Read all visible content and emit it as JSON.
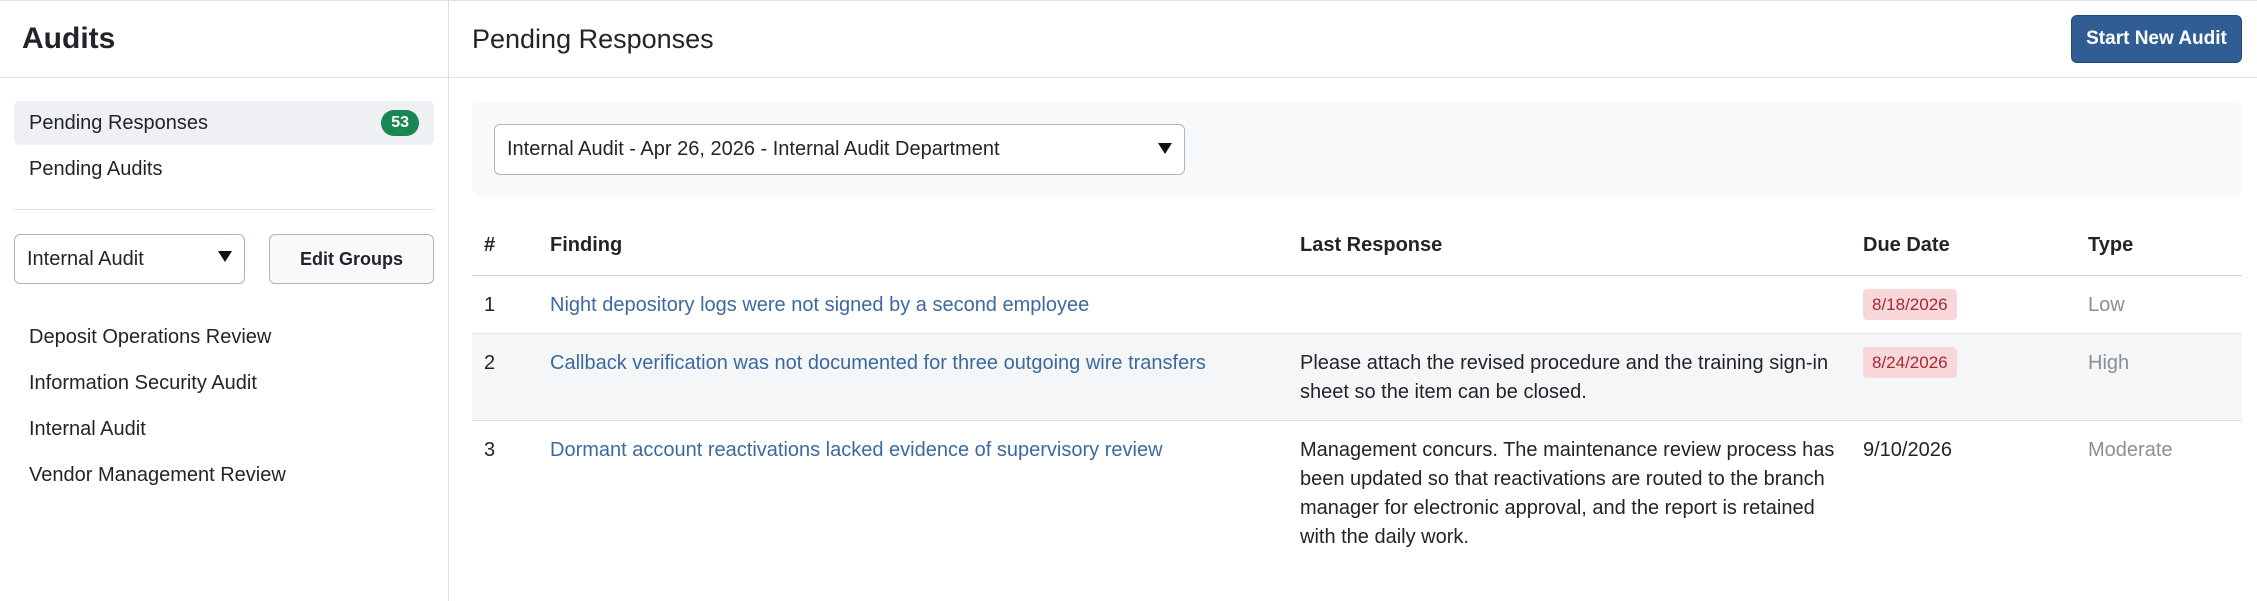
{
  "sidebar": {
    "title": "Audits",
    "nav": [
      {
        "label": "Pending Responses",
        "badge": "53",
        "active": true
      },
      {
        "label": "Pending Audits"
      }
    ],
    "group_select": {
      "value": "Internal Audit"
    },
    "edit_groups_label": "Edit Groups",
    "groups": [
      {
        "label": "Deposit Operations Review"
      },
      {
        "label": "Information Security Audit"
      },
      {
        "label": "Internal Audit"
      },
      {
        "label": "Vendor Management Review"
      }
    ]
  },
  "main": {
    "title": "Pending Responses",
    "start_button_label": "Start New Audit",
    "audit_select": {
      "value": "Internal Audit - Apr 26, 2026 - Internal Audit Department"
    },
    "table": {
      "headers": {
        "num": "#",
        "finding": "Finding",
        "last_response": "Last Response",
        "due_date": "Due Date",
        "type": "Type"
      },
      "rows": [
        {
          "num": "1",
          "finding": "Night depository logs were not signed by a second employee",
          "last_response": "",
          "due_date": "8/18/2026",
          "overdue": true,
          "type": "Low"
        },
        {
          "num": "2",
          "finding": "Callback verification was not documented for three outgoing wire transfers",
          "last_response": "Please attach the revised procedure and the training sign-in sheet so the item can be closed.",
          "due_date": "8/24/2026",
          "overdue": true,
          "type": "High"
        },
        {
          "num": "3",
          "finding": "Dormant account reactivations lacked evidence of supervisory review",
          "last_response": "Management concurs. The maintenance review process has been updated so that reactivations are routed to the branch manager for electronic approval, and the report is retained with the daily work.",
          "due_date": "9/10/2026",
          "overdue": false,
          "type": "Moderate"
        }
      ]
    }
  },
  "colors": {
    "primary": "#2f5d94",
    "badge_success": "#198754",
    "overdue_bg": "#f8d7da",
    "overdue_text": "#a52834",
    "link": "#3c6a9e"
  }
}
